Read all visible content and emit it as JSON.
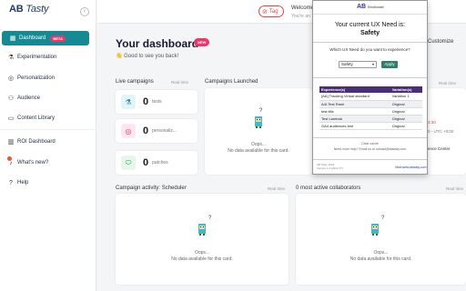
{
  "sidebar": {
    "logo_ab": "AB",
    "logo_tasty": "Tasty",
    "collapse_icon": "‹",
    "items": [
      {
        "label": "Dashboard",
        "badge": "BETA",
        "icon": "grid-icon"
      },
      {
        "label": "Experimentation",
        "icon": "flask-icon"
      },
      {
        "label": "Personalization",
        "icon": "target-icon"
      },
      {
        "label": "Audience",
        "icon": "users-icon"
      },
      {
        "label": "Content Library",
        "icon": "library-icon"
      },
      {
        "label": "ROI Dashboard",
        "icon": "chart-icon"
      },
      {
        "label": "What's new?",
        "icon": "bell-icon"
      },
      {
        "label": "Help",
        "icon": "help-icon"
      }
    ]
  },
  "header": {
    "tag_label": "Tag",
    "welcome": "Welcome,",
    "welcome_sub": "You're an"
  },
  "main": {
    "title": "Your dashboard",
    "new_badge": "NEW",
    "greeting": "👋 Good to see you back!",
    "customize": "Customize",
    "live_campaigns": {
      "label": "Live campaigns",
      "realtime": "Real time",
      "stats": [
        {
          "value": "0",
          "label": "tests"
        },
        {
          "value": "0",
          "label": "personaliz..."
        },
        {
          "value": "0",
          "label": "patches"
        }
      ]
    },
    "campaigns_launched": {
      "label": "Campaigns Launched",
      "nodata_1": "Oops...",
      "nodata_2": "No data available for this card."
    },
    "campaign_activity": {
      "label": "Campaign activity:",
      "sub": "Scheduler",
      "realtime": "Real time",
      "nodata_1": "Oops...",
      "nodata_2": "No data available for this card."
    },
    "collaborators": {
      "label": "0 most active collaborators",
      "realtime": "Real time",
      "nodata_1": "Oops...",
      "nodata_2": "No data available for this card."
    },
    "right_card": {
      "realtime": "Real time",
      "time1": "3:30",
      "time2": "0 - UTC +0:00",
      "label": "ence Center"
    }
  },
  "popup": {
    "logo_ab": "AB",
    "logo_sub": "Emotionabl",
    "line1": "Your current UX Need is:",
    "line2": "Safety",
    "question": "Which UX Need do you want to experience?",
    "select_value": "Safety",
    "apply_label": "Apply",
    "table": {
      "headers": [
        "Experience(s)",
        "Variation(s)"
      ],
      "rows": [
        [
          "[AA] Tracking Virtual standard",
          "Variation 1"
        ],
        [
          "A/A Test Rami",
          "Original"
        ],
        [
          "test title",
          "Original"
        ],
        [
          "Test Lambda",
          "Original"
        ],
        [
          "GA4 audiences test",
          "Original"
        ]
      ]
    },
    "clear": "Clear cache",
    "help": "Need more help? Email us at contact@abtasty.com",
    "version_1": "AB Tasty 2023",
    "version_2": "Version 1.0 (2023-??)",
    "visit_prefix": "Visit ",
    "visit_link": "www.abtasty.com"
  }
}
